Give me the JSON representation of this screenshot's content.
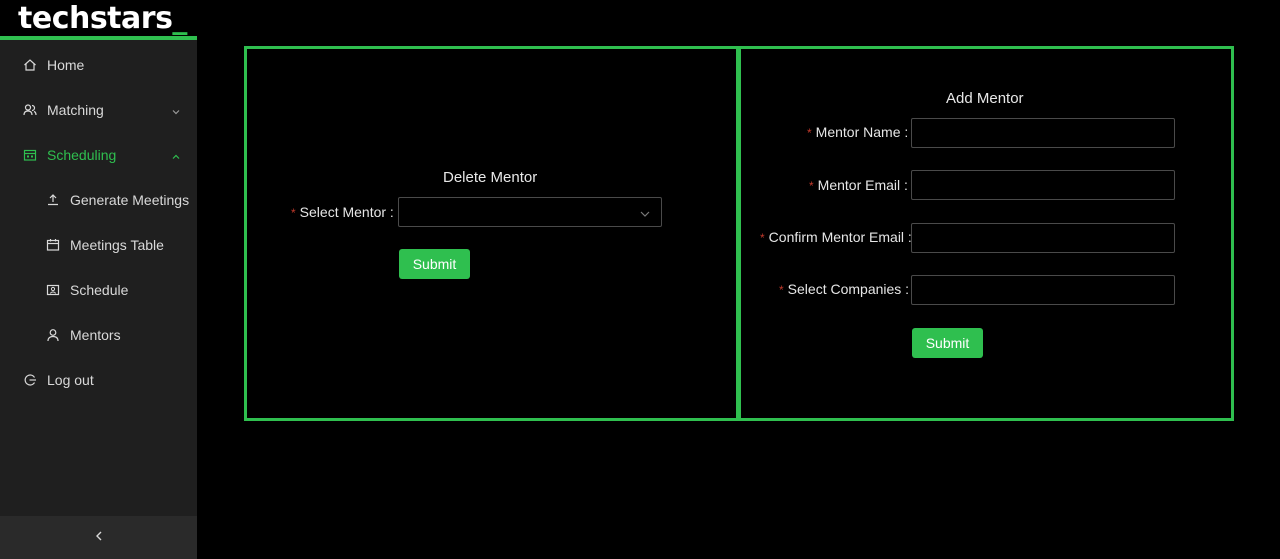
{
  "brand": {
    "logo_text": "techstars",
    "logo_cursor": "_",
    "accent": "#2fbf4f"
  },
  "sidebar": {
    "items": [
      {
        "label": "Home",
        "icon": "home-icon"
      },
      {
        "label": "Matching",
        "icon": "users-icon",
        "chevron": "down"
      },
      {
        "label": "Scheduling",
        "icon": "calendar-icon",
        "chevron": "up",
        "active": true
      },
      {
        "label": "Generate Meetings",
        "icon": "upload-icon"
      },
      {
        "label": "Meetings Table",
        "icon": "table-calendar-icon"
      },
      {
        "label": "Schedule",
        "icon": "schedule-icon"
      },
      {
        "label": "Mentors",
        "icon": "user-icon"
      },
      {
        "label": "Log out",
        "icon": "logout-icon"
      }
    ],
    "collapse_icon": "chevron-left-icon"
  },
  "delete_mentor": {
    "title": "Delete Mentor",
    "select_label": "Select Mentor",
    "select_value": "",
    "submit_label": "Submit"
  },
  "add_mentor": {
    "title": "Add Mentor",
    "name_label": "Mentor Name",
    "email_label": "Mentor Email",
    "confirm_email_label": "Confirm Mentor Email",
    "companies_label": "Select Companies",
    "name_value": "",
    "email_value": "",
    "confirm_email_value": "",
    "companies_value": "",
    "submit_label": "Submit"
  }
}
